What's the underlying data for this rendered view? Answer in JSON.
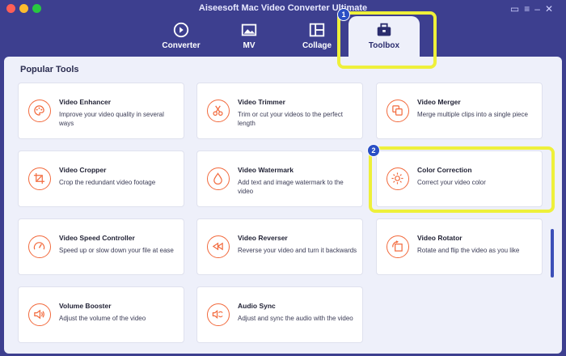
{
  "window": {
    "title": "Aiseesoft Mac Video Converter Ultimate"
  },
  "tabs": [
    {
      "label": "Converter",
      "icon": "converter-icon"
    },
    {
      "label": "MV",
      "icon": "mv-icon"
    },
    {
      "label": "Collage",
      "icon": "collage-icon"
    },
    {
      "label": "Toolbox",
      "icon": "toolbox-icon",
      "active": true
    }
  ],
  "section": {
    "title": "Popular Tools"
  },
  "tools": [
    {
      "title": "Video Enhancer",
      "desc": "Improve your video quality in several ways",
      "icon": "palette-icon"
    },
    {
      "title": "Video Trimmer",
      "desc": "Trim or cut your videos to the perfect length",
      "icon": "scissors-icon"
    },
    {
      "title": "Video Merger",
      "desc": "Merge multiple clips into a single piece",
      "icon": "merge-icon"
    },
    {
      "title": "Video Cropper",
      "desc": "Crop the redundant video footage",
      "icon": "crop-icon"
    },
    {
      "title": "Video Watermark",
      "desc": "Add text and image watermark to the video",
      "icon": "drop-icon"
    },
    {
      "title": "Color Correction",
      "desc": "Correct your video color",
      "icon": "sun-icon"
    },
    {
      "title": "Video Speed Controller",
      "desc": "Speed up or slow down your file at ease",
      "icon": "speedometer-icon"
    },
    {
      "title": "Video Reverser",
      "desc": "Reverse your video and turn it backwards",
      "icon": "rewind-icon"
    },
    {
      "title": "Video Rotator",
      "desc": "Rotate and flip the video as you like",
      "icon": "rotate-icon"
    },
    {
      "title": "Volume Booster",
      "desc": "Adjust the volume of the video",
      "icon": "volume-icon"
    },
    {
      "title": "Audio Sync",
      "desc": "Adjust and sync the audio with the video",
      "icon": "audio-sync-icon"
    }
  ],
  "annotations": {
    "badge1": "1",
    "badge2": "2"
  },
  "colors": {
    "accent": "#f26a3d",
    "header": "#3d3f8f",
    "highlight": "#eef03a"
  }
}
